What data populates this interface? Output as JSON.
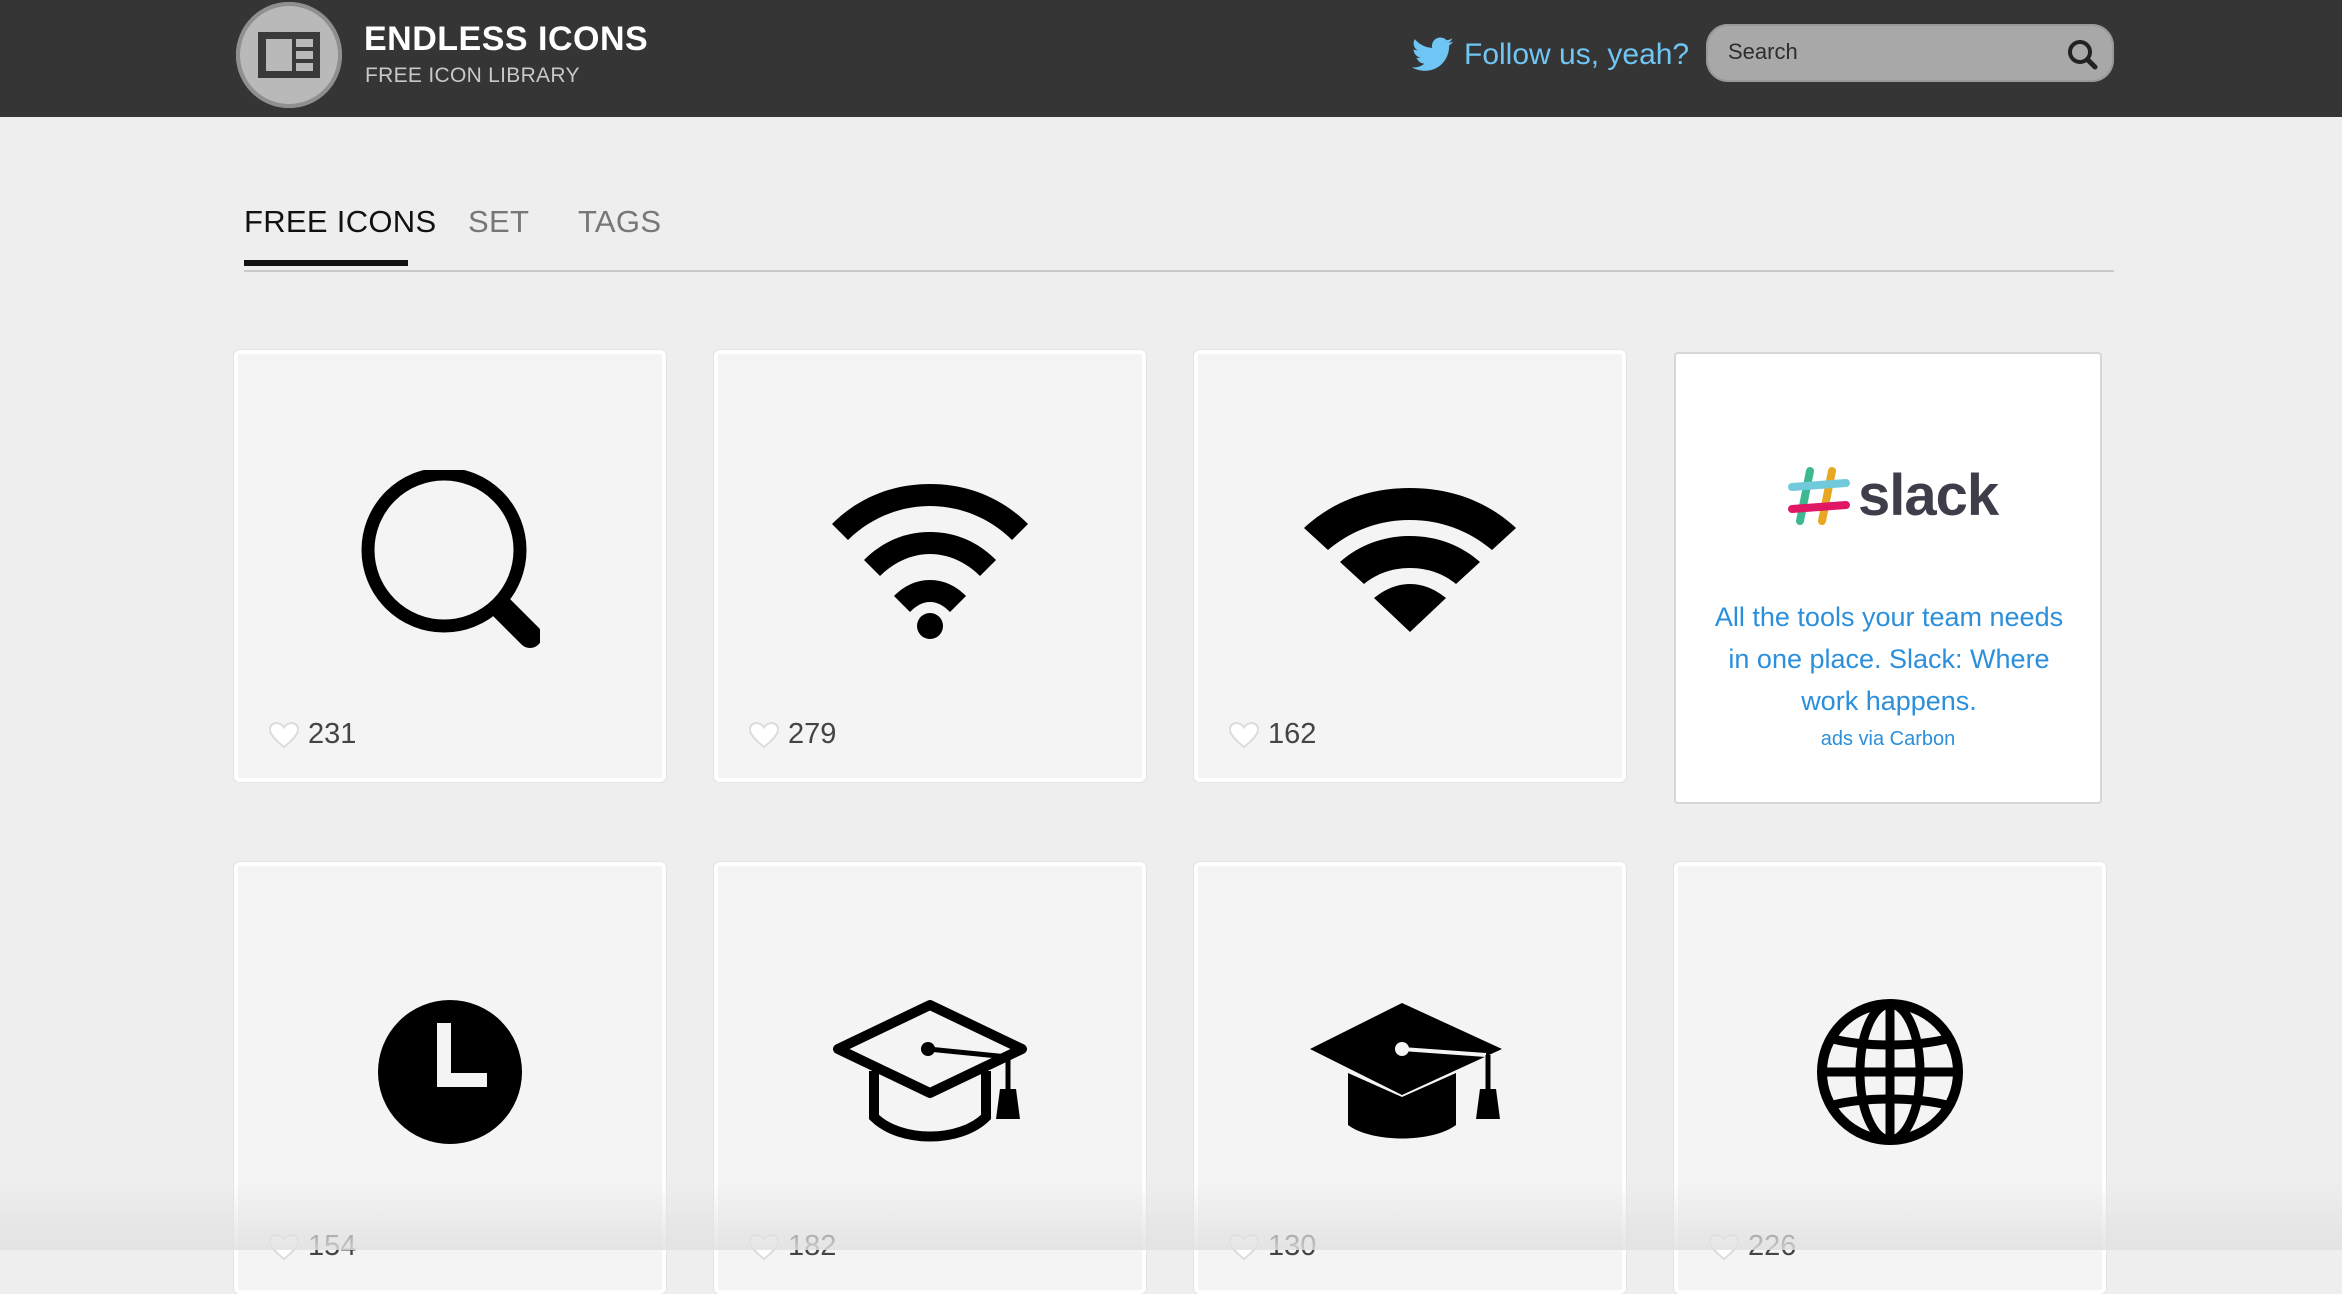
{
  "header": {
    "brand_title": "ENDLESS ICONS",
    "brand_subtitle": "FREE ICON LIBRARY",
    "follow_text": "Follow us, yeah?",
    "search_placeholder": "Search",
    "logo_icon": "layout-grid-icon",
    "twitter_icon": "twitter-bird-icon",
    "search_icon": "search-icon"
  },
  "tabs": [
    {
      "label": "FREE ICONS",
      "active": true
    },
    {
      "label": "SET",
      "active": false
    },
    {
      "label": "TAGS",
      "active": false
    }
  ],
  "cards": [
    {
      "icon": "search-icon",
      "likes": "231"
    },
    {
      "icon": "wifi-icon",
      "likes": "279"
    },
    {
      "icon": "wifi-filled-icon",
      "likes": "162"
    },
    {
      "icon": "clock-icon",
      "likes": "154"
    },
    {
      "icon": "graduation-cap-outline-icon",
      "likes": "182"
    },
    {
      "icon": "graduation-cap-icon",
      "likes": "130"
    },
    {
      "icon": "globe-icon",
      "likes": "226"
    }
  ],
  "ad": {
    "brand": "slack",
    "text": "All the tools your team needs in one place. Slack: Where work happens.",
    "via": "ads via Carbon"
  },
  "colors": {
    "header_bg": "#353535",
    "page_bg": "#eeeeee",
    "link_blue": "#6fc6f4",
    "ad_blue": "#2b8fdb"
  }
}
